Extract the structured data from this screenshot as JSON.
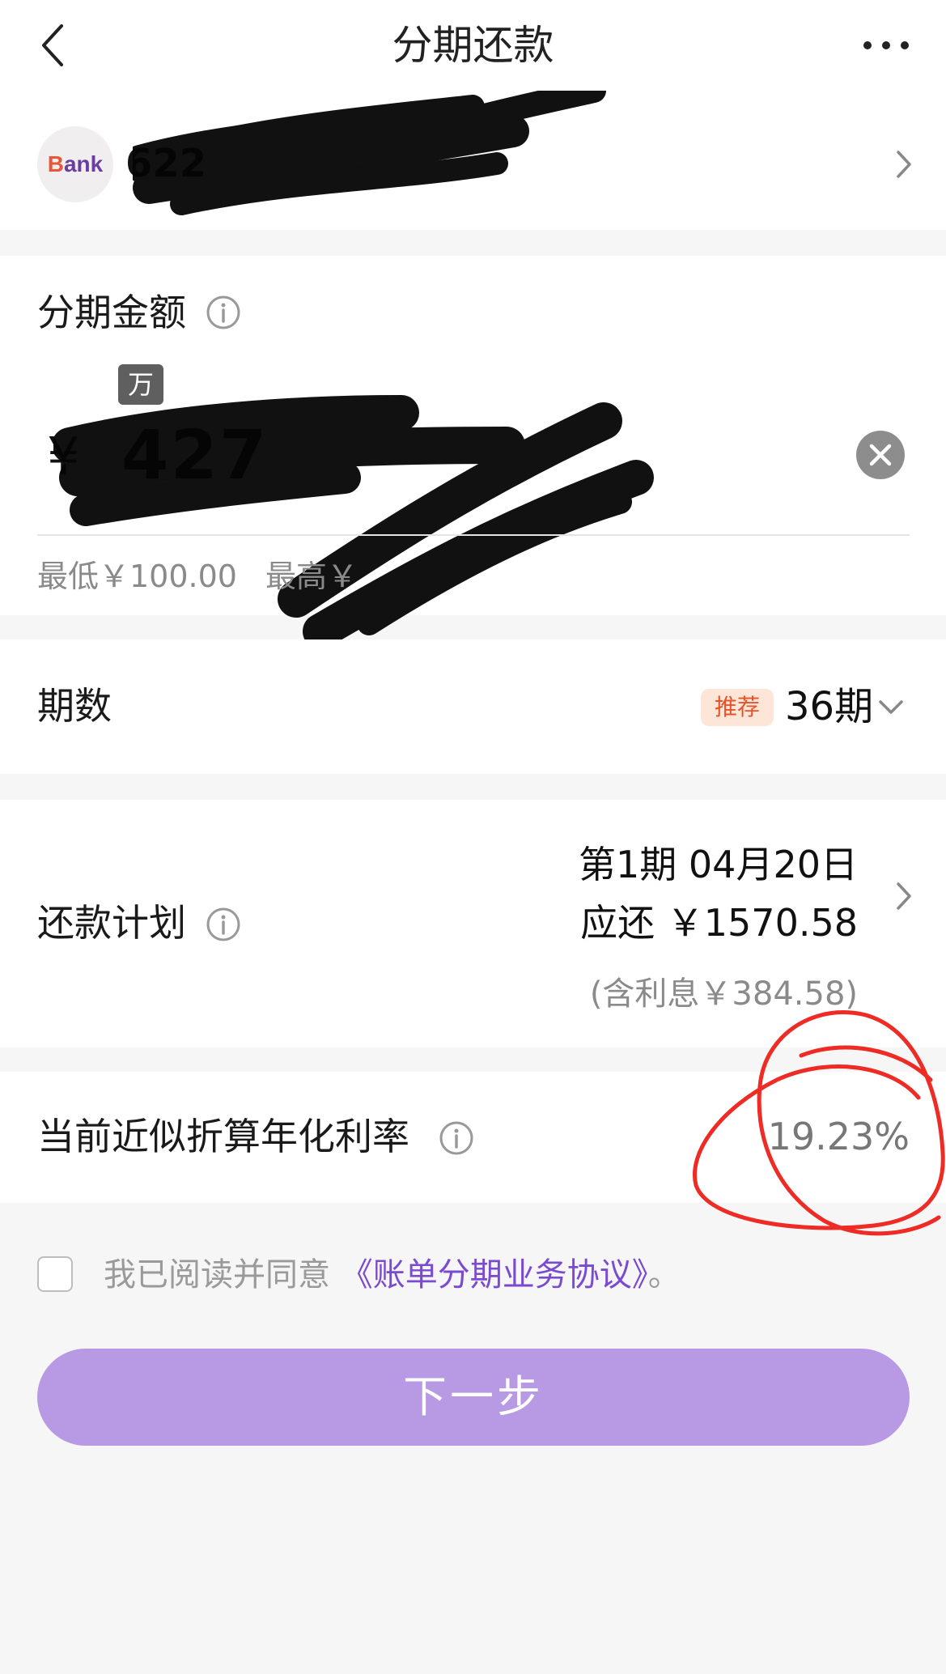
{
  "nav": {
    "title": "分期还款"
  },
  "card": {
    "bank_logo_text_first": "B",
    "bank_logo_text_rest": "ank",
    "number_visible": "622"
  },
  "amount": {
    "label": "分期金额",
    "unit_badge": "万",
    "currency_symbol": "¥",
    "value_visible": "427",
    "min_limit": "最低￥100.00",
    "max_limit_prefix": "最高￥"
  },
  "term": {
    "label": "期数",
    "recommend_tag": "推荐",
    "value": "36期"
  },
  "plan": {
    "label": "还款计划",
    "period_line": "第1期  04月20日",
    "due_line": "应还  ￥1570.58",
    "interest_line": "(含利息￥384.58)"
  },
  "rate": {
    "label": "当前近似折算年化利率",
    "value": "19.23%",
    "annotation_color": "#ee2b24"
  },
  "agreement": {
    "prefix": "我已阅读并同意",
    "link": "《账单分期业务协议》",
    "suffix": "。"
  },
  "next_button": {
    "label": "下一步"
  },
  "colors": {
    "accent_purple": "#7a4bd0",
    "button_purple": "#b899e3",
    "tag_orange": "#e5532a"
  }
}
